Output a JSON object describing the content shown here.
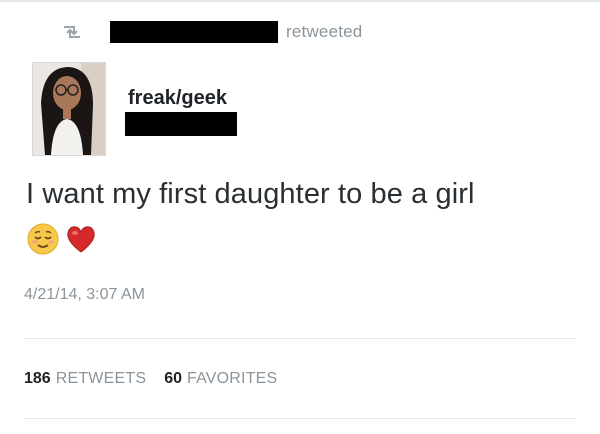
{
  "retweet_header": {
    "text": "retweeted",
    "icon": "retweet-icon"
  },
  "author": {
    "display_name": "freak/geek"
  },
  "tweet": {
    "text": "I want my first daughter to be a girl",
    "emojis": [
      "relieved-face-emoji",
      "red-heart-emoji"
    ]
  },
  "meta": {
    "timestamp": "4/21/14, 3:07 AM"
  },
  "stats": {
    "retweets_count": "186",
    "retweets_label": "RETWEETS",
    "favorites_count": "60",
    "favorites_label": "FAVORITES"
  },
  "colors": {
    "muted_text": "#8b949b",
    "heart": "#d62a2a",
    "emoji_face": "#f7c948"
  }
}
